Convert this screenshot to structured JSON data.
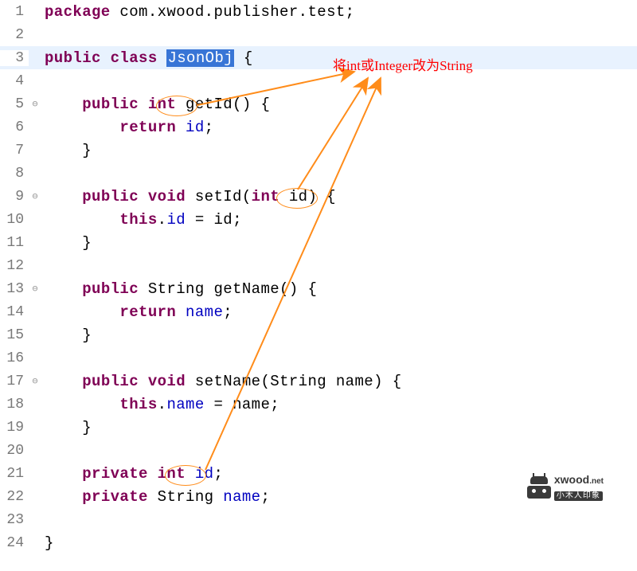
{
  "annotation": "将int或Integer改为String",
  "watermark": {
    "site": "xwood",
    "tld": ".net",
    "tagline": "小木人印象"
  },
  "lines": [
    {
      "n": "1",
      "fold": "",
      "hl": false,
      "tokens": [
        [
          "kw",
          "package"
        ],
        [
          "pln",
          " com.xwood.publisher.test;"
        ]
      ]
    },
    {
      "n": "2",
      "fold": "",
      "hl": false,
      "tokens": []
    },
    {
      "n": "3",
      "fold": "",
      "hl": true,
      "tokens": [
        [
          "kw",
          "public class "
        ],
        [
          "sel",
          "JsonObj"
        ],
        [
          "pln",
          " {"
        ]
      ]
    },
    {
      "n": "4",
      "fold": "",
      "hl": false,
      "tokens": []
    },
    {
      "n": "5",
      "fold": "⊖",
      "hl": false,
      "tokens": [
        [
          "pln",
          "    "
        ],
        [
          "kw",
          "public int"
        ],
        [
          "pln",
          " getId() {"
        ]
      ]
    },
    {
      "n": "6",
      "fold": "",
      "hl": false,
      "tokens": [
        [
          "pln",
          "        "
        ],
        [
          "kw",
          "return"
        ],
        [
          "pln",
          " "
        ],
        [
          "fld",
          "id"
        ],
        [
          "pln",
          ";"
        ]
      ]
    },
    {
      "n": "7",
      "fold": "",
      "hl": false,
      "tokens": [
        [
          "pln",
          "    }"
        ]
      ]
    },
    {
      "n": "8",
      "fold": "",
      "hl": false,
      "tokens": []
    },
    {
      "n": "9",
      "fold": "⊖",
      "hl": false,
      "tokens": [
        [
          "pln",
          "    "
        ],
        [
          "kw",
          "public void"
        ],
        [
          "pln",
          " setId("
        ],
        [
          "kw",
          "int"
        ],
        [
          "pln",
          " id) {"
        ]
      ]
    },
    {
      "n": "10",
      "fold": "",
      "hl": false,
      "tokens": [
        [
          "pln",
          "        "
        ],
        [
          "kw",
          "this"
        ],
        [
          "pln",
          "."
        ],
        [
          "fld",
          "id"
        ],
        [
          "pln",
          " = id;"
        ]
      ]
    },
    {
      "n": "11",
      "fold": "",
      "hl": false,
      "tokens": [
        [
          "pln",
          "    }"
        ]
      ]
    },
    {
      "n": "12",
      "fold": "",
      "hl": false,
      "tokens": []
    },
    {
      "n": "13",
      "fold": "⊖",
      "hl": false,
      "tokens": [
        [
          "pln",
          "    "
        ],
        [
          "kw",
          "public"
        ],
        [
          "pln",
          " String getName() {"
        ]
      ]
    },
    {
      "n": "14",
      "fold": "",
      "hl": false,
      "tokens": [
        [
          "pln",
          "        "
        ],
        [
          "kw",
          "return"
        ],
        [
          "pln",
          " "
        ],
        [
          "fld",
          "name"
        ],
        [
          "pln",
          ";"
        ]
      ]
    },
    {
      "n": "15",
      "fold": "",
      "hl": false,
      "tokens": [
        [
          "pln",
          "    }"
        ]
      ]
    },
    {
      "n": "16",
      "fold": "",
      "hl": false,
      "tokens": []
    },
    {
      "n": "17",
      "fold": "⊖",
      "hl": false,
      "tokens": [
        [
          "pln",
          "    "
        ],
        [
          "kw",
          "public void"
        ],
        [
          "pln",
          " setName(String name) {"
        ]
      ]
    },
    {
      "n": "18",
      "fold": "",
      "hl": false,
      "tokens": [
        [
          "pln",
          "        "
        ],
        [
          "kw",
          "this"
        ],
        [
          "pln",
          "."
        ],
        [
          "fld",
          "name"
        ],
        [
          "pln",
          " = name;"
        ]
      ]
    },
    {
      "n": "19",
      "fold": "",
      "hl": false,
      "tokens": [
        [
          "pln",
          "    }"
        ]
      ]
    },
    {
      "n": "20",
      "fold": "",
      "hl": false,
      "tokens": []
    },
    {
      "n": "21",
      "fold": "",
      "hl": false,
      "tokens": [
        [
          "pln",
          "    "
        ],
        [
          "kw",
          "private int"
        ],
        [
          "pln",
          " "
        ],
        [
          "fld",
          "id"
        ],
        [
          "pln",
          ";"
        ]
      ]
    },
    {
      "n": "22",
      "fold": "",
      "hl": false,
      "tokens": [
        [
          "pln",
          "    "
        ],
        [
          "kw",
          "private"
        ],
        [
          "pln",
          " String "
        ],
        [
          "fld",
          "name"
        ],
        [
          "pln",
          ";"
        ]
      ]
    },
    {
      "n": "23",
      "fold": "",
      "hl": false,
      "tokens": []
    },
    {
      "n": "24",
      "fold": "",
      "hl": false,
      "tokens": [
        [
          "pln",
          "}"
        ]
      ]
    }
  ]
}
